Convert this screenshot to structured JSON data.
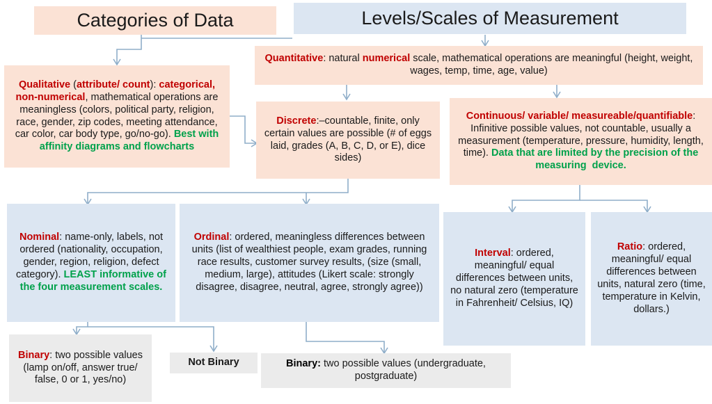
{
  "diagram": {
    "title_left": "Categories of Data",
    "title_right": "Levels/Scales of Measurement",
    "colors": {
      "peach": "#fbe2d5",
      "blue": "#dce6f2",
      "grey": "#ebebeb",
      "red_emphasis": "#c00000",
      "green_emphasis": "#00a14b",
      "connector": "#8faec9"
    },
    "nodes": {
      "qualitative": {
        "label": "Qualitative",
        "text": "Qualitative (attribute/ count): categorical, non-numerical, mathematical operations are meaningless (colors, political party, religion, race, gender, zip codes, meeting attendance, car color, car body type, go/no-go). Best with affinity diagrams and flowcharts",
        "emphasis_red": "Qualitative (attribute/ count): categorical, non-numerical,",
        "plain": "mathematical operations are meaningless (colors, political party, religion, race, gender, zip codes, meeting attendance, car color, car body type, go/no-go).",
        "emphasis_green": "Best with affinity diagrams and flowcharts"
      },
      "quantitative": {
        "label": "Quantitative",
        "emphasis_red_1": "Quantitative",
        "plain_1": ": natural ",
        "emphasis_red_2": "numerical",
        "plain_2": " scale, mathematical operations are meaningful (height, weight, wages, temp, time, age, value)"
      },
      "discrete": {
        "label": "Discrete",
        "plain": ":–countable, finite, only certain values are possible (# of eggs laid, grades (A, B, C, D, or E), dice sides)"
      },
      "continuous": {
        "label": "Continuous/ variable/ measureable/quantifiable",
        "plain": ": Infinitive possible values, not countable, usually a measurement (temperature, pressure, humidity, length, time). ",
        "emphasis_green": "Data that are limited by the precision of the measuring  device."
      },
      "nominal": {
        "label": "Nominal",
        "plain": ": name-only, labels, not ordered (nationality, occupation, gender, region, religion, defect category). ",
        "emphasis_green": "LEAST informative of the four measurement scales."
      },
      "ordinal": {
        "label": "Ordinal",
        "plain": ": ordered, meaningless differences between units (list of wealthiest people, exam grades, running race results, customer survey results, (size (small, medium, large), attitudes (Likert scale: strongly disagree, disagree, neutral, agree, strongly agree))"
      },
      "interval": {
        "label": "Interval",
        "plain": ": ordered, meaningful/ equal differences between units, no natural zero (temperature in Fahrenheit/ Celsius, IQ)"
      },
      "ratio": {
        "label": "Ratio",
        "plain": ": ordered, meaningful/ equal differences between units, natural zero (time, temperature in Kelvin, dollars.)"
      },
      "binary_left": {
        "label": "Binary",
        "plain": ": two possible values (lamp on/off, answer true/ false, 0 or 1, yes/no)"
      },
      "not_binary": {
        "label": "Not Binary"
      },
      "binary_right": {
        "label": "Binary:",
        "plain": " two possible values (undergraduate, postgraduate)"
      }
    }
  }
}
